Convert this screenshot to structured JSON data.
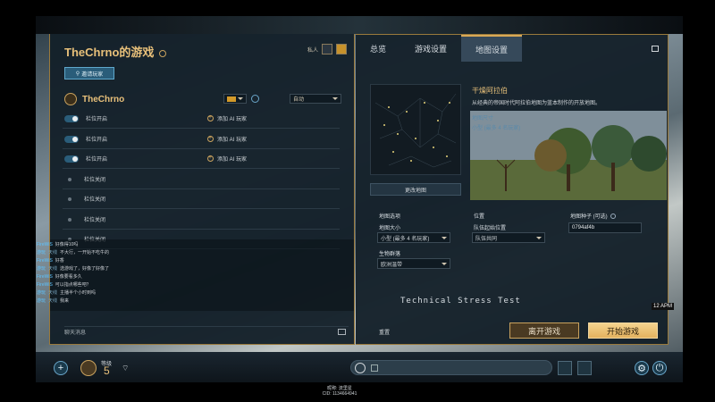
{
  "lobby": {
    "title": "TheChrno的游戏",
    "private_label": "私人",
    "invite_label": "邀请玩家",
    "host": {
      "name": "TheChrno",
      "team": "自动"
    },
    "slots": [
      {
        "label": "栏位开启",
        "open": true,
        "add_ai": "添加 AI 玩家"
      },
      {
        "label": "栏位开启",
        "open": true,
        "add_ai": "添加 AI 玩家"
      },
      {
        "label": "栏位开启",
        "open": true,
        "add_ai": "添加 AI 玩家"
      },
      {
        "label": "栏位关闭",
        "open": false
      },
      {
        "label": "栏位关闭",
        "open": false
      },
      {
        "label": "栏位关闭",
        "open": false
      },
      {
        "label": "栏位关闭",
        "open": false
      }
    ],
    "chat": [
      {
        "who": "FireWiS",
        "channel": "",
        "text": "好像得10吗"
      },
      {
        "who": "游玩",
        "channel": "天线",
        "text": "不大行，一开始不吃牛的"
      },
      {
        "who": "FireWiS",
        "channel": "",
        "text": "好香"
      },
      {
        "who": "游玩",
        "channel": "天线",
        "text": "选游戏了，好像了好像了"
      },
      {
        "who": "FireWiS",
        "channel": "",
        "text": "好像要看多久"
      },
      {
        "who": "FireWiS",
        "channel": "",
        "text": "可以指点哪些吧？"
      },
      {
        "who": "游玩",
        "channel": "天线",
        "text": "主播半个小时到吗"
      },
      {
        "who": "游玩",
        "channel": "天线",
        "text": "我来"
      }
    ],
    "chat_input_placeholder": "聊天消息"
  },
  "tabs": [
    "总览",
    "游戏设置",
    "地图设置"
  ],
  "active_tab": 2,
  "map": {
    "name": "干燥阿拉伯",
    "description": "从经典的帝国时代阿拉伯地图为蓝本制作的开放地图。",
    "sub1": "地图尺寸",
    "sub2": "小型 (最多 4 名玩家)",
    "change_label": "更改地图"
  },
  "options": {
    "section_label": "地图选项",
    "size_label": "地图大小",
    "size_value": "小型 (最多 4 名玩家)",
    "biome_label": "生物群落",
    "biome_value": "欧洲温带",
    "position_label": "位置",
    "team_start_label": "队伍起始位置",
    "team_start_value": "队伍共同",
    "seed_label": "地图种子 (可选)",
    "seed_value": "0794af4b"
  },
  "overlay_text": "Technical Stress Test",
  "time_badge": "12 APM",
  "reset_label": "重置",
  "leave_label": "离开游戏",
  "start_label": "开始游戏",
  "bottom": {
    "turn_label": "等级",
    "turn_value": "5",
    "footer_line1": "昵称: 流里星",
    "footer_line2": "CID: 1134664941"
  }
}
